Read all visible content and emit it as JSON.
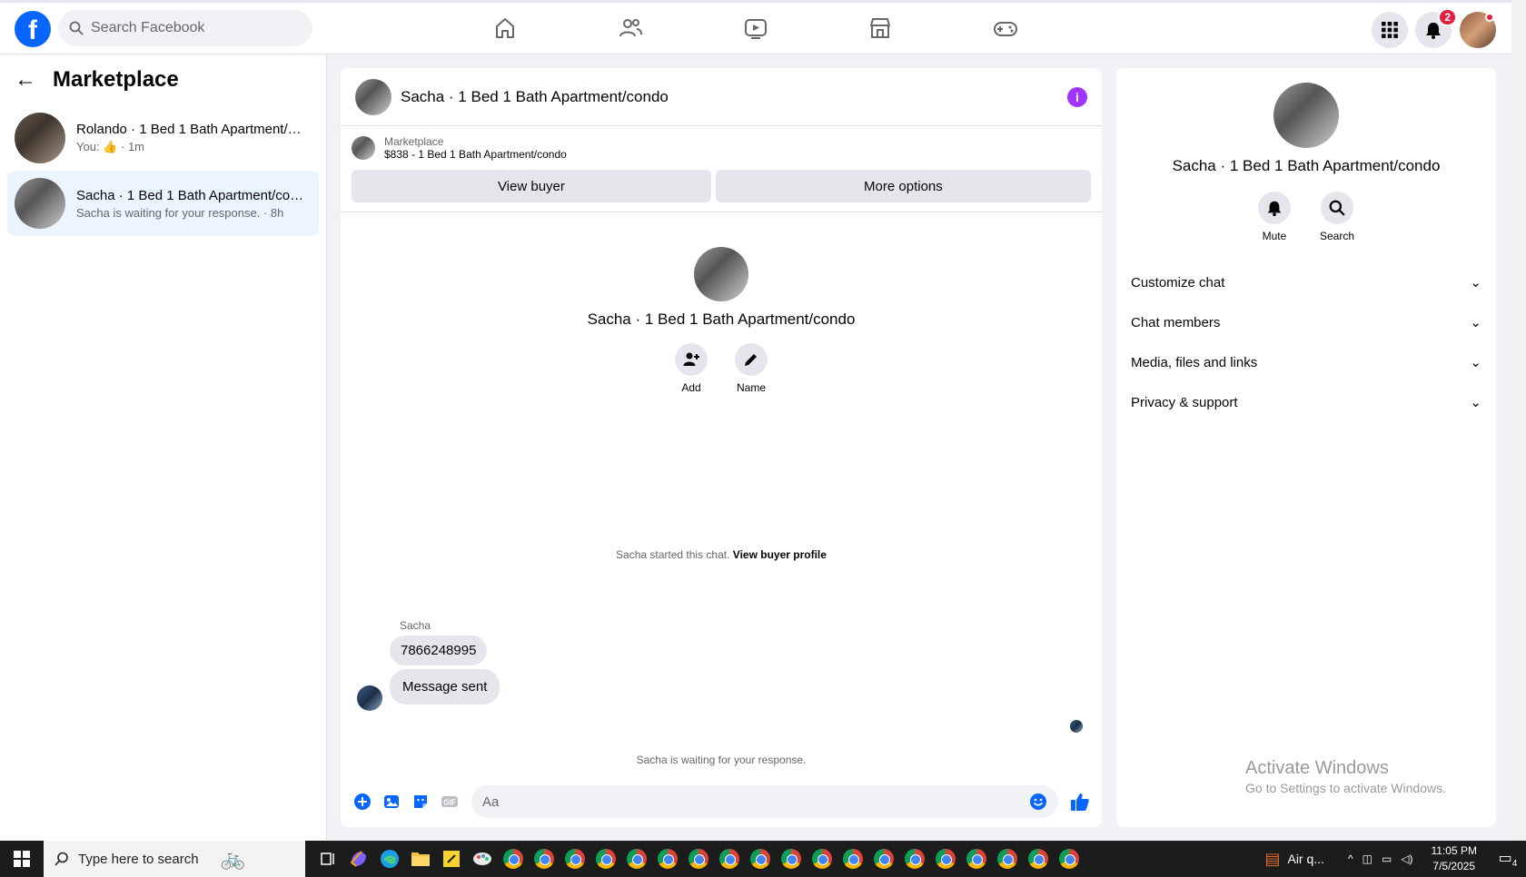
{
  "topbar": {
    "logo": "f",
    "search_placeholder": "Search Facebook",
    "notifications_count": "2"
  },
  "sidebar": {
    "title": "Marketplace",
    "conversations": [
      {
        "title": "Rolando · 1 Bed 1 Bath Apartment/condo",
        "sub_prefix": "You:",
        "sub_suffix": "· 1m"
      },
      {
        "title": "Sacha · 1 Bed 1 Bath Apartment/condo",
        "sub": "Sacha is waiting for your response. · 8h"
      }
    ]
  },
  "chat": {
    "header_title": "Sacha · 1 Bed 1 Bath Apartment/condo",
    "marketplace_label": "Marketplace",
    "listing": "$838 - 1 Bed 1 Bath Apartment/condo",
    "view_buyer": "View buyer",
    "more_options": "More options",
    "intro_name": "Sacha · 1 Bed 1 Bath Apartment/condo",
    "add_label": "Add",
    "name_label": "Name",
    "started_text": "Sacha started this chat.",
    "view_profile": "View buyer profile",
    "sender": "Sacha",
    "messages": [
      "7866248995",
      "Message sent"
    ],
    "waiting": "Sacha is waiting for your response.",
    "composer_placeholder": "Aa"
  },
  "details": {
    "name": "Sacha · 1 Bed 1 Bath Apartment/condo",
    "mute": "Mute",
    "search": "Search",
    "sections": [
      "Customize chat",
      "Chat members",
      "Media, files and links",
      "Privacy & support"
    ],
    "watermark_title": "Activate Windows",
    "watermark_sub": "Go to Settings to activate Windows."
  },
  "taskbar": {
    "search_text": "Type here to search",
    "weather": "Air q...",
    "time": "11:05 PM",
    "date": "7/5/2025",
    "notif_count": "4"
  },
  "colors": {
    "brand": "#0866ff",
    "accent": "#a033ff",
    "active_bg": "#ebf5ff"
  }
}
